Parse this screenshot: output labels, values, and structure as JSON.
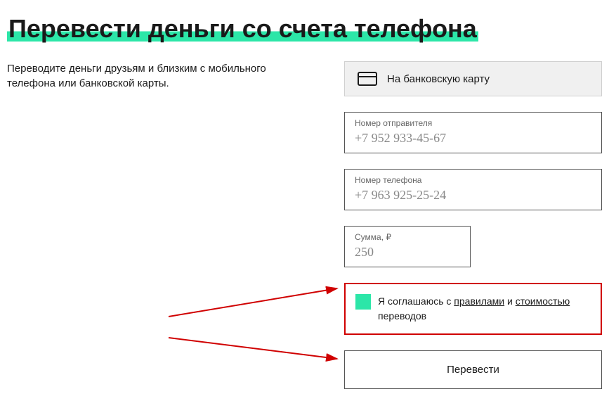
{
  "title": "Перевести деньги со счета телефона",
  "description": "Переводите деньги друзьям и близким с мобильного телефона или банковской карты.",
  "tab": {
    "label": "На банковскую карту"
  },
  "fields": {
    "sender": {
      "label": "Номер отправителя",
      "value": "+7 952 933-45-67"
    },
    "phone": {
      "label": "Номер телефона",
      "value": "+7 963 925-25-24"
    },
    "amount": {
      "label": "Сумма, ₽",
      "value": "250"
    }
  },
  "consent": {
    "text_prefix": "Я соглашаюсь с ",
    "rules_link": "правилами",
    "text_middle": " и ",
    "cost_link": "стоимостью",
    "text_suffix": " переводов"
  },
  "submit_label": "Перевести"
}
